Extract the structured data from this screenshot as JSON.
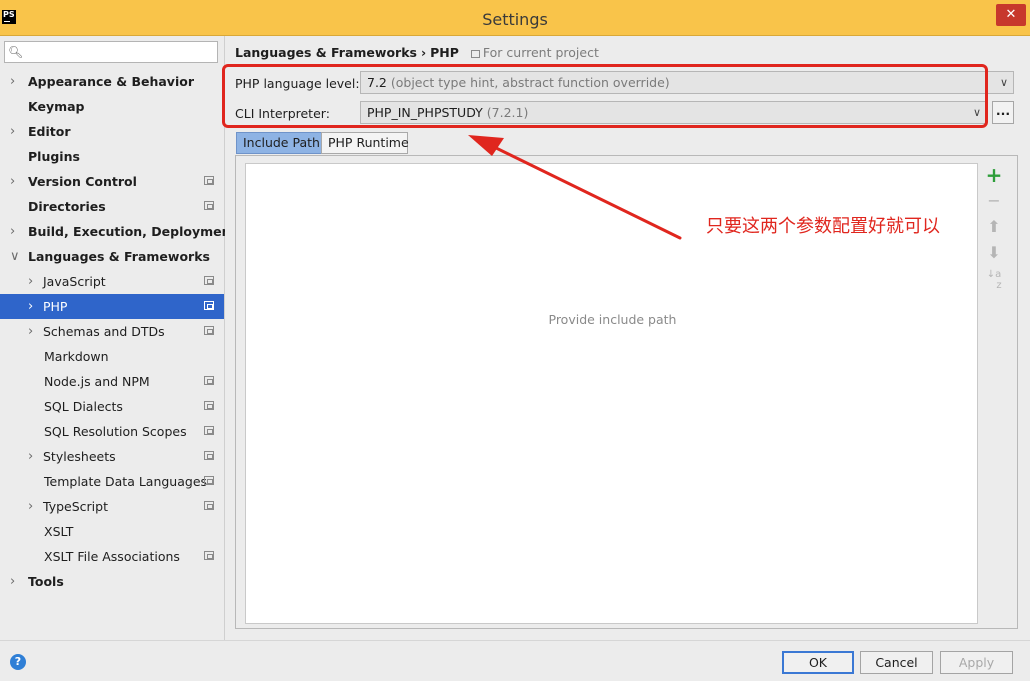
{
  "window": {
    "title": "Settings",
    "app_icon": "PS",
    "close_label": "✕"
  },
  "search": {
    "placeholder": ""
  },
  "sidebar": {
    "items": [
      {
        "label": "Appearance & Behavior",
        "bold": true,
        "arrow": "right",
        "indent": 0,
        "project": false
      },
      {
        "label": "Keymap",
        "bold": true,
        "arrow": "none",
        "indent": 0,
        "project": false
      },
      {
        "label": "Editor",
        "bold": true,
        "arrow": "right",
        "indent": 0,
        "project": false
      },
      {
        "label": "Plugins",
        "bold": true,
        "arrow": "none",
        "indent": 0,
        "project": false
      },
      {
        "label": "Version Control",
        "bold": true,
        "arrow": "right",
        "indent": 0,
        "project": true
      },
      {
        "label": "Directories",
        "bold": true,
        "arrow": "none",
        "indent": 0,
        "project": true
      },
      {
        "label": "Build, Execution, Deployment",
        "bold": true,
        "arrow": "right",
        "indent": 0,
        "project": false
      },
      {
        "label": "Languages & Frameworks",
        "bold": true,
        "arrow": "down",
        "indent": 0,
        "project": false
      },
      {
        "label": "JavaScript",
        "bold": false,
        "arrow": "right",
        "indent": 1,
        "project": true
      },
      {
        "label": "PHP",
        "bold": false,
        "arrow": "right",
        "indent": 1,
        "project": true,
        "selected": true
      },
      {
        "label": "Schemas and DTDs",
        "bold": false,
        "arrow": "right",
        "indent": 1,
        "project": true
      },
      {
        "label": "Markdown",
        "bold": false,
        "arrow": "none",
        "indent": 1,
        "project": false
      },
      {
        "label": "Node.js and NPM",
        "bold": false,
        "arrow": "none",
        "indent": 1,
        "project": true
      },
      {
        "label": "SQL Dialects",
        "bold": false,
        "arrow": "none",
        "indent": 1,
        "project": true
      },
      {
        "label": "SQL Resolution Scopes",
        "bold": false,
        "arrow": "none",
        "indent": 1,
        "project": true
      },
      {
        "label": "Stylesheets",
        "bold": false,
        "arrow": "right",
        "indent": 1,
        "project": true
      },
      {
        "label": "Template Data Languages",
        "bold": false,
        "arrow": "none",
        "indent": 1,
        "project": true
      },
      {
        "label": "TypeScript",
        "bold": false,
        "arrow": "right",
        "indent": 1,
        "project": true
      },
      {
        "label": "XSLT",
        "bold": false,
        "arrow": "none",
        "indent": 1,
        "project": false
      },
      {
        "label": "XSLT File Associations",
        "bold": false,
        "arrow": "none",
        "indent": 1,
        "project": true
      },
      {
        "label": "Tools",
        "bold": true,
        "arrow": "right",
        "indent": 0,
        "project": false
      }
    ]
  },
  "breadcrumb": {
    "section": "Languages & Frameworks",
    "separator": "›",
    "page": "PHP",
    "scope": "For current project"
  },
  "php_language_level": {
    "label": "PHP language level:",
    "value": "7.2",
    "hint": "(object type hint, abstract function override)"
  },
  "cli_interpreter": {
    "label": "CLI Interpreter:",
    "value": "PHP_IN_PHPSTUDY",
    "hint": "(7.2.1)",
    "browse_label": "..."
  },
  "tabs": [
    {
      "label": "Include Path",
      "active": true
    },
    {
      "label": "PHP Runtime",
      "active": false
    }
  ],
  "include_path": {
    "empty_text": "Provide include path"
  },
  "annotation": {
    "text": "只要这两个参数配置好就可以",
    "color": "#e0261e"
  },
  "footer": {
    "help_label": "?",
    "ok_label": "OK",
    "cancel_label": "Cancel",
    "apply_label": "Apply"
  },
  "colors": {
    "title_bar": "#f9c44a",
    "selection": "#2f65ca",
    "active_tab": "#8eb3e4",
    "add_icon": "#2e9e3a",
    "close_button": "#c7382c"
  }
}
